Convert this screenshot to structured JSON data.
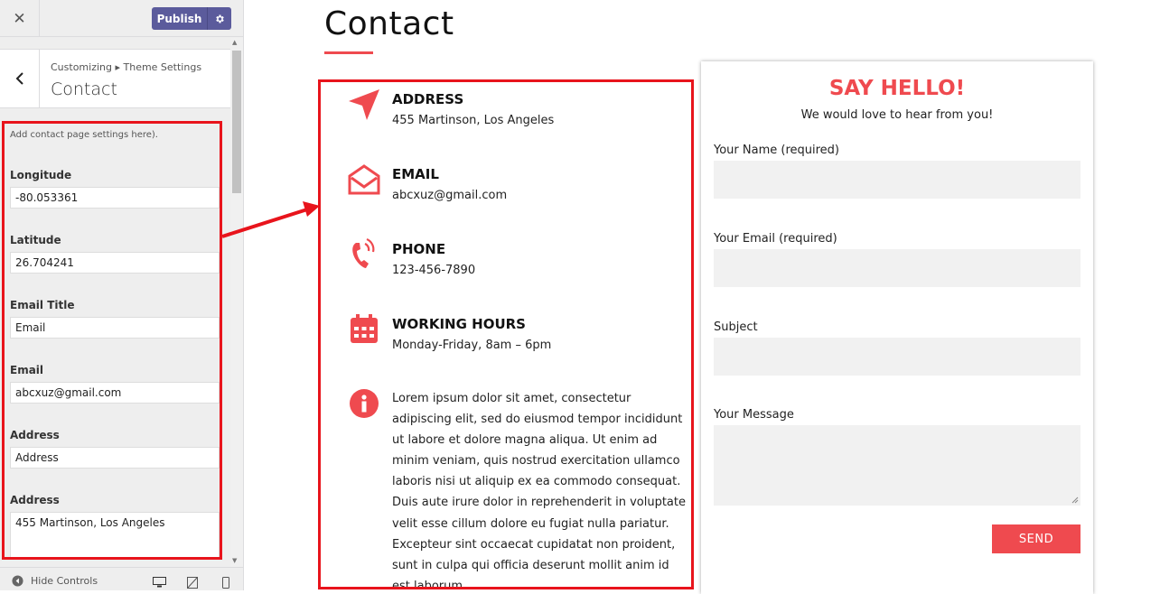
{
  "customizer": {
    "close_icon": "✕",
    "publish_label": "Publish",
    "breadcrumb": "Customizing ▸ Theme Settings",
    "section_title": "Contact",
    "description": "Add contact page settings here).",
    "fields": [
      {
        "label": "Longitude",
        "value": "-80.053361"
      },
      {
        "label": "Latitude",
        "value": "26.704241"
      },
      {
        "label": "Email Title",
        "value": "Email"
      },
      {
        "label": "Email",
        "value": "abcxuz@gmail.com"
      },
      {
        "label": "Address",
        "value": "Address"
      },
      {
        "label": "Address",
        "value": "455 Martinson, Los Angeles"
      }
    ],
    "hide_controls_label": "Hide Controls"
  },
  "preview": {
    "page_title": "Contact",
    "info": [
      {
        "icon": "location-arrow-icon",
        "heading": "ADDRESS",
        "text": "455 Martinson, Los Angeles"
      },
      {
        "icon": "envelope-open-icon",
        "heading": "EMAIL",
        "text": "abcxuz@gmail.com"
      },
      {
        "icon": "phone-icon",
        "heading": "PHONE",
        "text": "123-456-7890"
      },
      {
        "icon": "calendar-icon",
        "heading": "WORKING HOURS",
        "text": "Monday-Friday, 8am – 6pm"
      }
    ],
    "lorem": "Lorem ipsum dolor sit amet, consectetur adipiscing elit, sed do eiusmod tempor incididunt ut labore et dolore magna aliqua. Ut enim ad minim veniam, quis nostrud exercitation ullamco laboris nisi ut aliquip ex ea commodo consequat. Duis aute irure dolor in reprehenderit in voluptate velit esse cillum dolore eu fugiat nulla pariatur. Excepteur sint occaecat cupidatat non proident, sunt in culpa qui officia deserunt mollit anim id est laborum.",
    "form": {
      "title": "SAY HELLO!",
      "subtitle": "We would love to hear from you!",
      "name_label": "Your Name (required)",
      "email_label": "Your Email (required)",
      "subject_label": "Subject",
      "message_label": "Your Message",
      "send_label": "SEND"
    }
  },
  "colors": {
    "accent": "#ef4a4f",
    "highlight": "#e8141c",
    "publish": "#5b5b9c"
  }
}
